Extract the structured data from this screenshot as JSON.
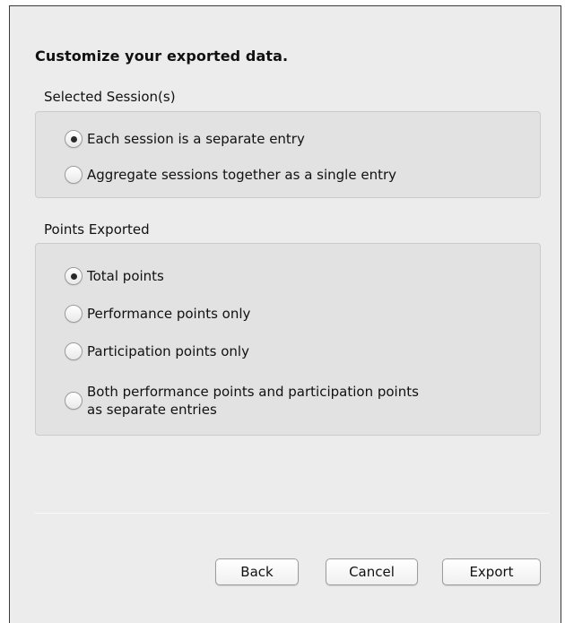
{
  "heading": "Customize your exported data.",
  "sessions_group": {
    "label": "Selected Session(s)",
    "options": [
      {
        "label": "Each session is a separate entry",
        "checked": true
      },
      {
        "label": "Aggregate sessions together as a single entry",
        "checked": false
      }
    ]
  },
  "points_group": {
    "label": "Points Exported",
    "options": [
      {
        "label": "Total points",
        "checked": true
      },
      {
        "label": "Performance points only",
        "checked": false
      },
      {
        "label": "Participation points only",
        "checked": false
      },
      {
        "label_line1": "Both performance points and participation points",
        "label_line2": "as separate entries",
        "checked": false
      }
    ]
  },
  "buttons": {
    "back": "Back",
    "cancel": "Cancel",
    "export": "Export"
  }
}
